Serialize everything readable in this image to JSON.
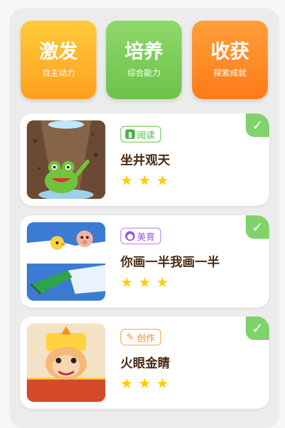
{
  "top_cards": [
    {
      "title": "激发",
      "subtitle": "自主动力"
    },
    {
      "title": "培养",
      "subtitle": "综合能力"
    },
    {
      "title": "收获",
      "subtitle": "探索成就"
    }
  ],
  "stories": [
    {
      "tag": "阅读",
      "title": "坐井观天",
      "stars": 3
    },
    {
      "tag": "美育",
      "title": "你画一半我画一半",
      "stars": 3
    },
    {
      "tag": "创作",
      "title": "火眼金睛",
      "stars": 3
    }
  ],
  "check_glyph": "✓",
  "star_glyph": "★",
  "colors": {
    "reading": "#4bb34a",
    "art": "#9a54e6",
    "create": "#f08a1e"
  }
}
